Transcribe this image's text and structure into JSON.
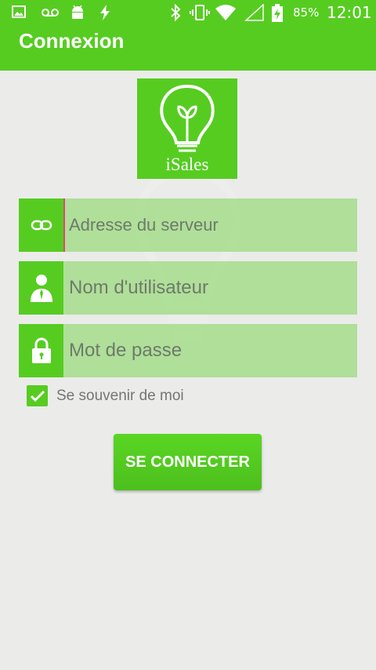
{
  "status_bar": {
    "battery_percent": "85%",
    "time": "12:01",
    "left_icons": [
      "image-icon",
      "voicemail-icon",
      "android-icon",
      "flash-icon"
    ],
    "right_icons": [
      "bluetooth-icon",
      "vibrate-icon",
      "wifi-icon",
      "signal-icon",
      "battery-charging-icon"
    ]
  },
  "app_bar": {
    "title": "Connexion"
  },
  "logo": {
    "text": "iSales",
    "icon": "lightbulb-icon"
  },
  "form": {
    "server_field": {
      "placeholder": "Adresse du serveur",
      "value": "",
      "icon": "link-icon"
    },
    "username_field": {
      "placeholder": "Nom d'utilisateur",
      "value": "",
      "icon": "user-icon"
    },
    "password_field": {
      "placeholder": "Mot de passe",
      "value": "",
      "icon": "lock-icon"
    },
    "remember_me": {
      "label": "Se souvenir de moi",
      "checked": true
    },
    "submit_label": "SE CONNECTER"
  },
  "colors": {
    "primary": "#56cc21",
    "field_bg": "#a9d7a6",
    "background": "#ebebea",
    "cursor": "#e2457a"
  }
}
